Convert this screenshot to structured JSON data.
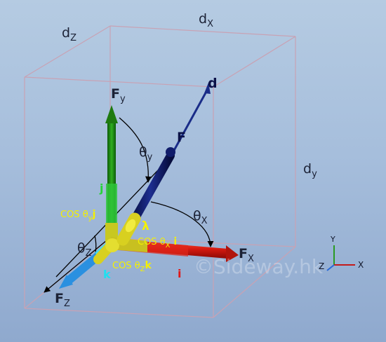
{
  "box": {
    "dx": "d",
    "dx_sub": "X",
    "dy": "d",
    "dy_sub": "y",
    "dz": "d",
    "dz_sub": "Z"
  },
  "vector": {
    "d_label": "d",
    "F_label": "F",
    "lambda_label": "λ"
  },
  "components": {
    "Fx": "F",
    "Fx_sub": "X",
    "Fy": "F",
    "Fy_sub": "y",
    "Fz": "F",
    "Fz_sub": "Z"
  },
  "angles": {
    "theta_x": "θ",
    "theta_x_sub": "X",
    "theta_y": "θ",
    "theta_y_sub": "y",
    "theta_z": "θ",
    "theta_z_sub": "Z"
  },
  "unit_vectors": {
    "i": "i",
    "j": "j",
    "k": "k"
  },
  "direction_cosines": {
    "cx_pre": "COS θ",
    "cx_sub": "X",
    "cx_vec": " i",
    "cy_pre": "COS θ",
    "cy_sub": "y",
    "cy_vec": "j",
    "cz_pre": "COS θ",
    "cz_sub": "Z",
    "cz_vec": "k"
  },
  "watermark": "©Sideway.hk",
  "axes_triad": {
    "y": "Y",
    "x": "X",
    "z": "Z"
  },
  "colors": {
    "background": "#a6bedc",
    "x_axis": "#d81a10",
    "y_axis": "#1e8a12",
    "z_axis": "#2a90e0",
    "force_vector": "#0d1a6a",
    "box_edges": "#c8a2b4",
    "direction_cosine": "#f4f000"
  }
}
